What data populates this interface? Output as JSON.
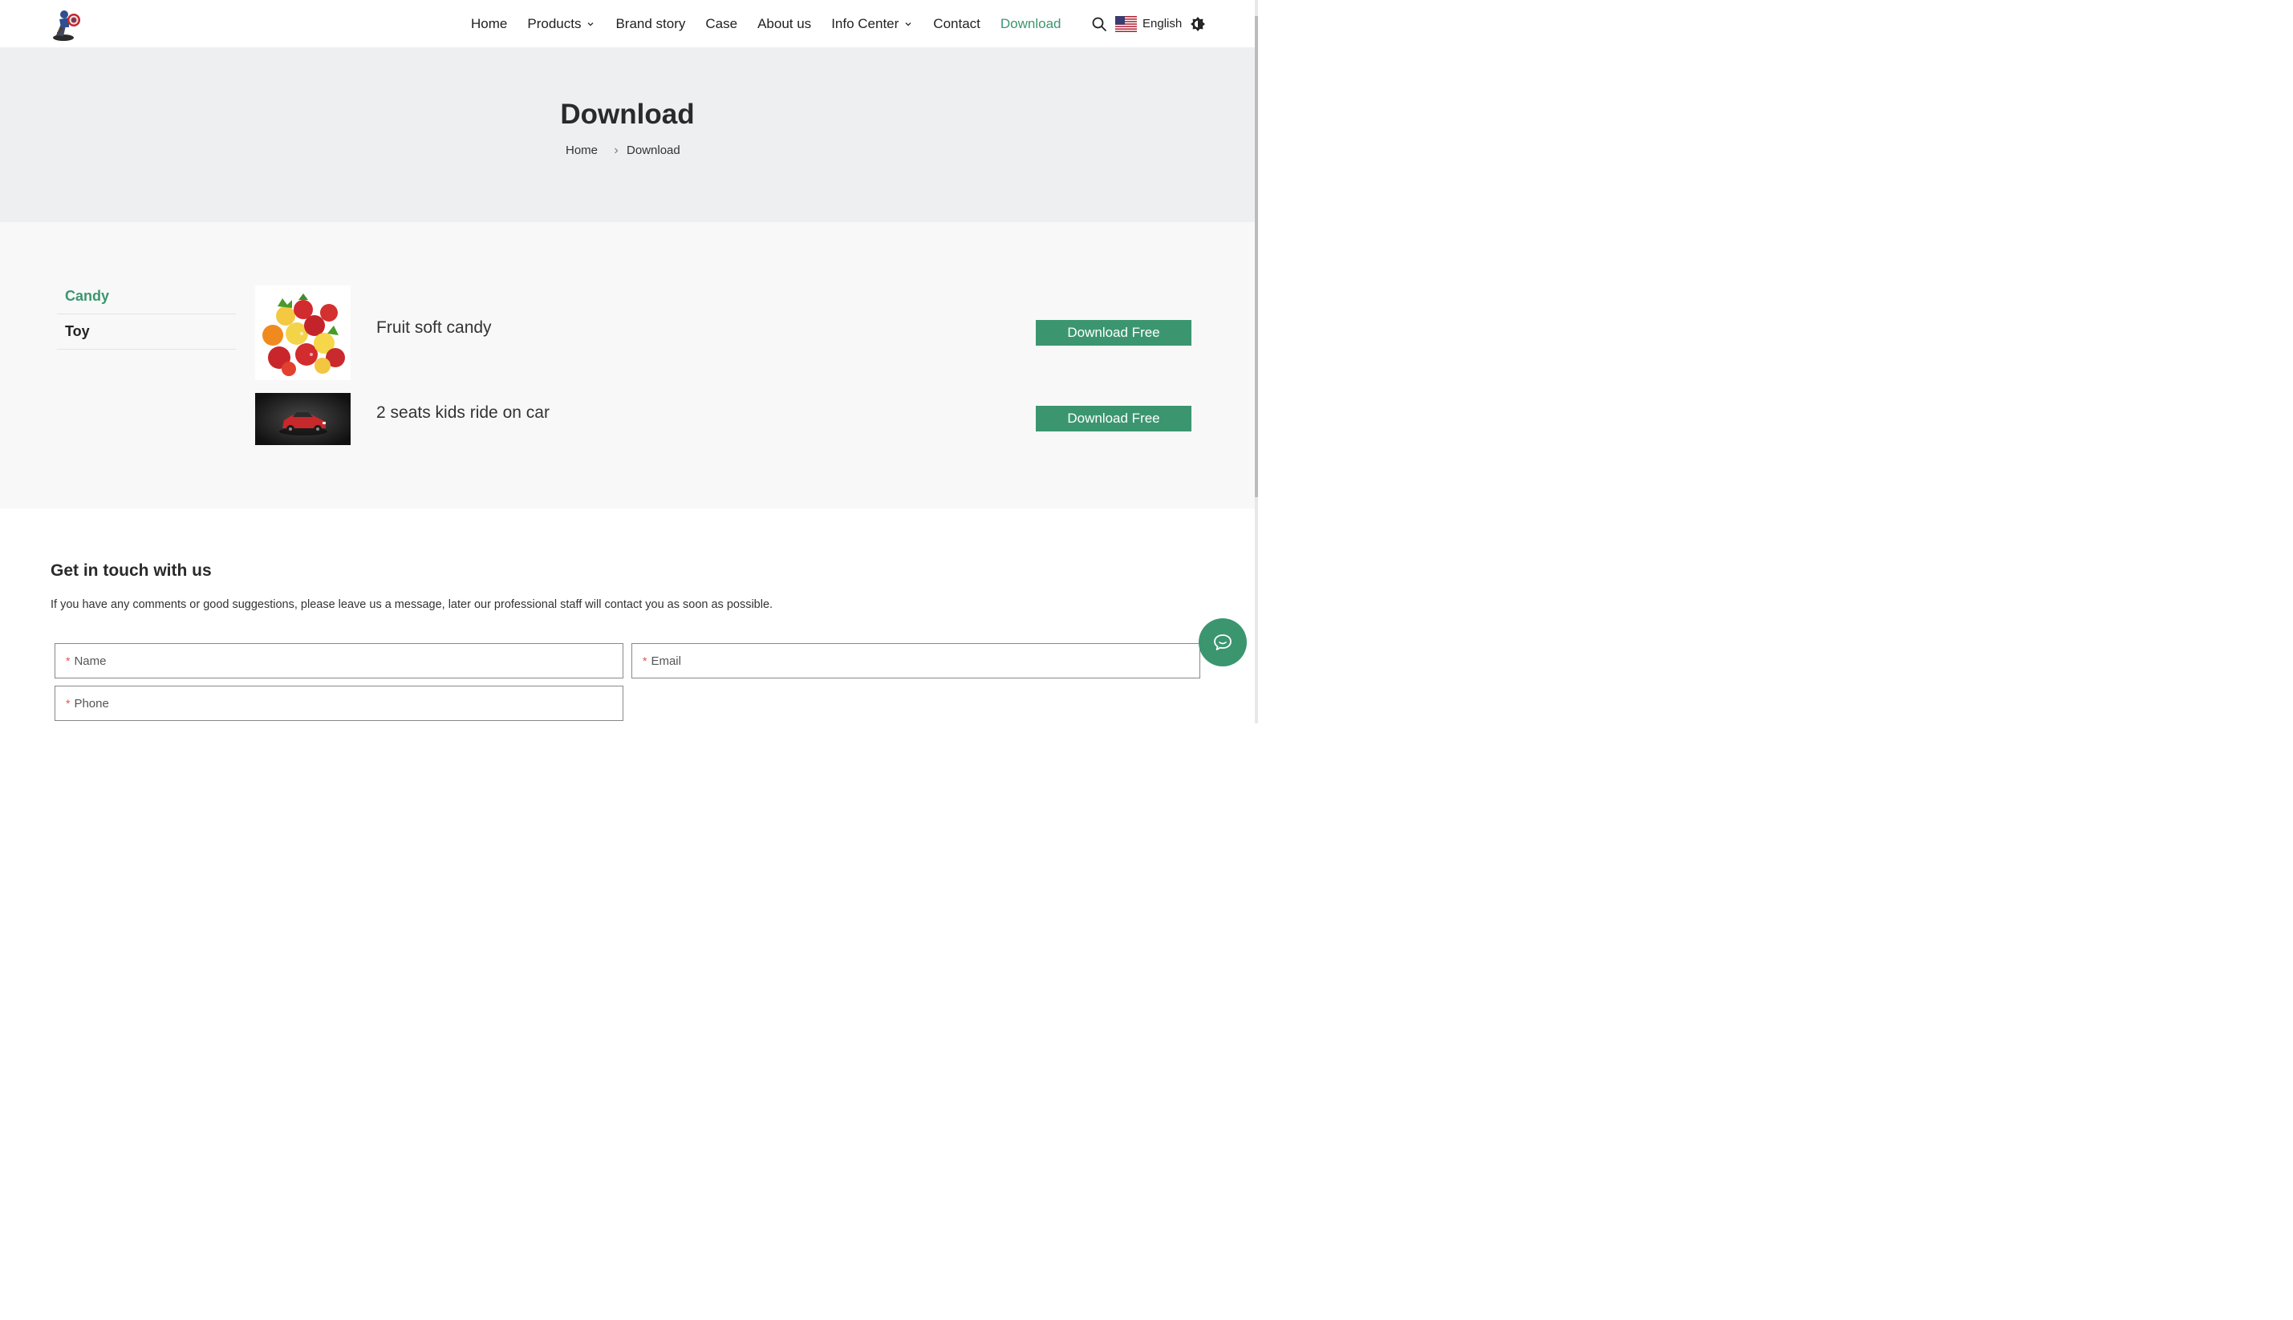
{
  "header": {
    "nav": [
      {
        "label": "Home",
        "dropdown": false,
        "active": false
      },
      {
        "label": "Products",
        "dropdown": true,
        "active": false
      },
      {
        "label": "Brand story",
        "dropdown": false,
        "active": false
      },
      {
        "label": "Case",
        "dropdown": false,
        "active": false
      },
      {
        "label": "About us",
        "dropdown": false,
        "active": false
      },
      {
        "label": "Info Center",
        "dropdown": true,
        "active": false
      },
      {
        "label": "Contact",
        "dropdown": false,
        "active": false
      },
      {
        "label": "Download",
        "dropdown": false,
        "active": true
      }
    ],
    "language": "English",
    "icons": {
      "search": "search-icon",
      "flag": "us-flag-icon",
      "theme": "theme-toggle-icon"
    }
  },
  "banner": {
    "title": "Download",
    "breadcrumb": [
      "Home",
      "Download"
    ]
  },
  "categories": [
    {
      "label": "Candy",
      "active": true
    },
    {
      "label": "Toy",
      "active": false
    }
  ],
  "downloads": [
    {
      "name": "Fruit soft candy",
      "button": "Download Free",
      "thumb": "fruit-candy-image"
    },
    {
      "name": "2 seats kids ride on car",
      "button": "Download Free",
      "thumb": "red-car-image"
    }
  ],
  "contact": {
    "title": "Get in touch with us",
    "description": "If you have any comments or good suggestions, please leave us a message, later our professional staff will contact you as soon as possible.",
    "fields": {
      "name": {
        "placeholder": "Name",
        "value": ""
      },
      "email": {
        "placeholder": "Email",
        "value": ""
      },
      "phone": {
        "placeholder": "Phone",
        "value": ""
      }
    },
    "required_mark": "*"
  },
  "colors": {
    "accent": "#3b9670",
    "banner_bg": "#eeeff0",
    "section_bg": "#f8f8f8"
  }
}
